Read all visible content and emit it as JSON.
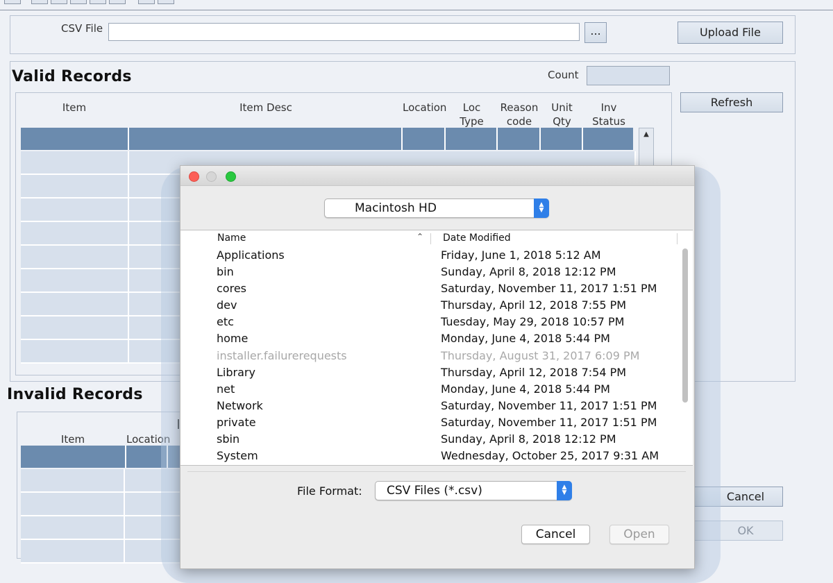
{
  "form": {
    "csv_label": "CSV File",
    "csv_value": "",
    "browse_label": "...",
    "upload_label": "Upload File",
    "count_label": "Count",
    "count_value": "",
    "refresh_label": "Refresh",
    "cancel_label": "Cancel",
    "ok_label": "OK"
  },
  "valid_records": {
    "title": "Valid Records",
    "columns": [
      {
        "line1": "",
        "line2": "Item"
      },
      {
        "line1": "",
        "line2": "Item Desc"
      },
      {
        "line1": "",
        "line2": "Location"
      },
      {
        "line1": "Loc",
        "line2": "Type"
      },
      {
        "line1": "Reason",
        "line2": "code"
      },
      {
        "line1": "Unit",
        "line2": "Qty"
      },
      {
        "line1": "Inv",
        "line2": "Status"
      }
    ]
  },
  "invalid_records": {
    "title": "Invalid Records",
    "columns": [
      "Item",
      "Location"
    ]
  },
  "dialog": {
    "location": "Macintosh HD",
    "columns": {
      "name": "Name",
      "date": "Date Modified"
    },
    "files": [
      {
        "name": "Applications",
        "date": "Friday, June 1, 2018 5:12 AM",
        "enabled": true
      },
      {
        "name": "bin",
        "date": "Sunday, April 8, 2018 12:12 PM",
        "enabled": true
      },
      {
        "name": "cores",
        "date": "Saturday, November 11, 2017 1:51 PM",
        "enabled": true
      },
      {
        "name": "dev",
        "date": "Thursday, April 12, 2018 7:55 PM",
        "enabled": true
      },
      {
        "name": "etc",
        "date": "Tuesday, May 29, 2018 10:57 PM",
        "enabled": true
      },
      {
        "name": "home",
        "date": "Monday, June 4, 2018 5:44 PM",
        "enabled": true
      },
      {
        "name": "installer.failurerequests",
        "date": "Thursday, August 31, 2017 6:09 PM",
        "enabled": false
      },
      {
        "name": "Library",
        "date": "Thursday, April 12, 2018 7:54 PM",
        "enabled": true
      },
      {
        "name": "net",
        "date": "Monday, June 4, 2018 5:44 PM",
        "enabled": true
      },
      {
        "name": "Network",
        "date": "Saturday, November 11, 2017 1:51 PM",
        "enabled": true
      },
      {
        "name": "private",
        "date": "Saturday, November 11, 2017 1:51 PM",
        "enabled": true
      },
      {
        "name": "sbin",
        "date": "Sunday, April 8, 2018 12:12 PM",
        "enabled": true
      },
      {
        "name": "System",
        "date": "Wednesday, October 25, 2017 9:31 AM",
        "enabled": true
      }
    ],
    "file_format_label": "File Format:",
    "file_format_value": "CSV Files (*.csv)",
    "cancel_label": "Cancel",
    "open_label": "Open"
  },
  "colors": {
    "grid_header": "#6b8bae",
    "grid_cell": "#d7e0ec",
    "mac_accent": "#2f7fe8"
  }
}
